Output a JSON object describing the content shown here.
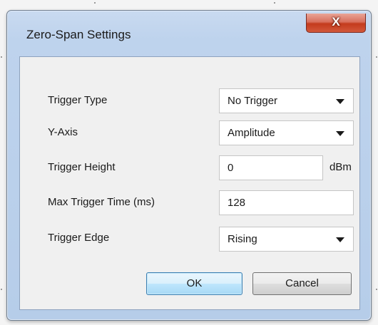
{
  "dialog": {
    "title": "Zero-Span Settings",
    "close_icon": "x-close-icon",
    "close_glyph": "X"
  },
  "form": {
    "trigger_type": {
      "label": "Trigger Type",
      "value": "No Trigger"
    },
    "y_axis": {
      "label": "Y-Axis",
      "value": "Amplitude"
    },
    "trigger_height": {
      "label": "Trigger Height",
      "value": "0",
      "unit": "dBm"
    },
    "max_trigger_time": {
      "label": "Max Trigger Time  (ms)",
      "value": "128"
    },
    "trigger_edge": {
      "label": "Trigger Edge",
      "value": "Rising"
    }
  },
  "buttons": {
    "ok": "OK",
    "cancel": "Cancel"
  },
  "colors": {
    "frame": "#bed3ed",
    "close_button": "#c43b1d",
    "default_button_border": "#3c7fb1"
  }
}
